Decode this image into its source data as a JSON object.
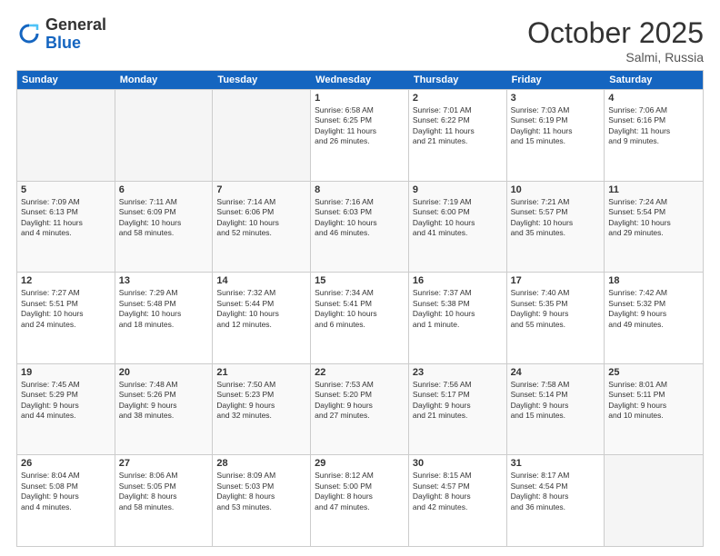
{
  "header": {
    "logo_general": "General",
    "logo_blue": "Blue",
    "month": "October 2025",
    "location": "Salmi, Russia"
  },
  "days_of_week": [
    "Sunday",
    "Monday",
    "Tuesday",
    "Wednesday",
    "Thursday",
    "Friday",
    "Saturday"
  ],
  "weeks": [
    [
      {
        "day": "",
        "empty": true,
        "lines": []
      },
      {
        "day": "",
        "empty": true,
        "lines": []
      },
      {
        "day": "",
        "empty": true,
        "lines": []
      },
      {
        "day": "1",
        "lines": [
          "Sunrise: 6:58 AM",
          "Sunset: 6:25 PM",
          "Daylight: 11 hours",
          "and 26 minutes."
        ]
      },
      {
        "day": "2",
        "lines": [
          "Sunrise: 7:01 AM",
          "Sunset: 6:22 PM",
          "Daylight: 11 hours",
          "and 21 minutes."
        ]
      },
      {
        "day": "3",
        "lines": [
          "Sunrise: 7:03 AM",
          "Sunset: 6:19 PM",
          "Daylight: 11 hours",
          "and 15 minutes."
        ]
      },
      {
        "day": "4",
        "lines": [
          "Sunrise: 7:06 AM",
          "Sunset: 6:16 PM",
          "Daylight: 11 hours",
          "and 9 minutes."
        ]
      }
    ],
    [
      {
        "day": "5",
        "lines": [
          "Sunrise: 7:09 AM",
          "Sunset: 6:13 PM",
          "Daylight: 11 hours",
          "and 4 minutes."
        ]
      },
      {
        "day": "6",
        "lines": [
          "Sunrise: 7:11 AM",
          "Sunset: 6:09 PM",
          "Daylight: 10 hours",
          "and 58 minutes."
        ]
      },
      {
        "day": "7",
        "lines": [
          "Sunrise: 7:14 AM",
          "Sunset: 6:06 PM",
          "Daylight: 10 hours",
          "and 52 minutes."
        ]
      },
      {
        "day": "8",
        "lines": [
          "Sunrise: 7:16 AM",
          "Sunset: 6:03 PM",
          "Daylight: 10 hours",
          "and 46 minutes."
        ]
      },
      {
        "day": "9",
        "lines": [
          "Sunrise: 7:19 AM",
          "Sunset: 6:00 PM",
          "Daylight: 10 hours",
          "and 41 minutes."
        ]
      },
      {
        "day": "10",
        "lines": [
          "Sunrise: 7:21 AM",
          "Sunset: 5:57 PM",
          "Daylight: 10 hours",
          "and 35 minutes."
        ]
      },
      {
        "day": "11",
        "lines": [
          "Sunrise: 7:24 AM",
          "Sunset: 5:54 PM",
          "Daylight: 10 hours",
          "and 29 minutes."
        ]
      }
    ],
    [
      {
        "day": "12",
        "lines": [
          "Sunrise: 7:27 AM",
          "Sunset: 5:51 PM",
          "Daylight: 10 hours",
          "and 24 minutes."
        ]
      },
      {
        "day": "13",
        "lines": [
          "Sunrise: 7:29 AM",
          "Sunset: 5:48 PM",
          "Daylight: 10 hours",
          "and 18 minutes."
        ]
      },
      {
        "day": "14",
        "lines": [
          "Sunrise: 7:32 AM",
          "Sunset: 5:44 PM",
          "Daylight: 10 hours",
          "and 12 minutes."
        ]
      },
      {
        "day": "15",
        "lines": [
          "Sunrise: 7:34 AM",
          "Sunset: 5:41 PM",
          "Daylight: 10 hours",
          "and 6 minutes."
        ]
      },
      {
        "day": "16",
        "lines": [
          "Sunrise: 7:37 AM",
          "Sunset: 5:38 PM",
          "Daylight: 10 hours",
          "and 1 minute."
        ]
      },
      {
        "day": "17",
        "lines": [
          "Sunrise: 7:40 AM",
          "Sunset: 5:35 PM",
          "Daylight: 9 hours",
          "and 55 minutes."
        ]
      },
      {
        "day": "18",
        "lines": [
          "Sunrise: 7:42 AM",
          "Sunset: 5:32 PM",
          "Daylight: 9 hours",
          "and 49 minutes."
        ]
      }
    ],
    [
      {
        "day": "19",
        "lines": [
          "Sunrise: 7:45 AM",
          "Sunset: 5:29 PM",
          "Daylight: 9 hours",
          "and 44 minutes."
        ]
      },
      {
        "day": "20",
        "lines": [
          "Sunrise: 7:48 AM",
          "Sunset: 5:26 PM",
          "Daylight: 9 hours",
          "and 38 minutes."
        ]
      },
      {
        "day": "21",
        "lines": [
          "Sunrise: 7:50 AM",
          "Sunset: 5:23 PM",
          "Daylight: 9 hours",
          "and 32 minutes."
        ]
      },
      {
        "day": "22",
        "lines": [
          "Sunrise: 7:53 AM",
          "Sunset: 5:20 PM",
          "Daylight: 9 hours",
          "and 27 minutes."
        ]
      },
      {
        "day": "23",
        "lines": [
          "Sunrise: 7:56 AM",
          "Sunset: 5:17 PM",
          "Daylight: 9 hours",
          "and 21 minutes."
        ]
      },
      {
        "day": "24",
        "lines": [
          "Sunrise: 7:58 AM",
          "Sunset: 5:14 PM",
          "Daylight: 9 hours",
          "and 15 minutes."
        ]
      },
      {
        "day": "25",
        "lines": [
          "Sunrise: 8:01 AM",
          "Sunset: 5:11 PM",
          "Daylight: 9 hours",
          "and 10 minutes."
        ]
      }
    ],
    [
      {
        "day": "26",
        "lines": [
          "Sunrise: 8:04 AM",
          "Sunset: 5:08 PM",
          "Daylight: 9 hours",
          "and 4 minutes."
        ]
      },
      {
        "day": "27",
        "lines": [
          "Sunrise: 8:06 AM",
          "Sunset: 5:05 PM",
          "Daylight: 8 hours",
          "and 58 minutes."
        ]
      },
      {
        "day": "28",
        "lines": [
          "Sunrise: 8:09 AM",
          "Sunset: 5:03 PM",
          "Daylight: 8 hours",
          "and 53 minutes."
        ]
      },
      {
        "day": "29",
        "lines": [
          "Sunrise: 8:12 AM",
          "Sunset: 5:00 PM",
          "Daylight: 8 hours",
          "and 47 minutes."
        ]
      },
      {
        "day": "30",
        "lines": [
          "Sunrise: 8:15 AM",
          "Sunset: 4:57 PM",
          "Daylight: 8 hours",
          "and 42 minutes."
        ]
      },
      {
        "day": "31",
        "lines": [
          "Sunrise: 8:17 AM",
          "Sunset: 4:54 PM",
          "Daylight: 8 hours",
          "and 36 minutes."
        ]
      },
      {
        "day": "",
        "empty": true,
        "lines": []
      }
    ]
  ]
}
